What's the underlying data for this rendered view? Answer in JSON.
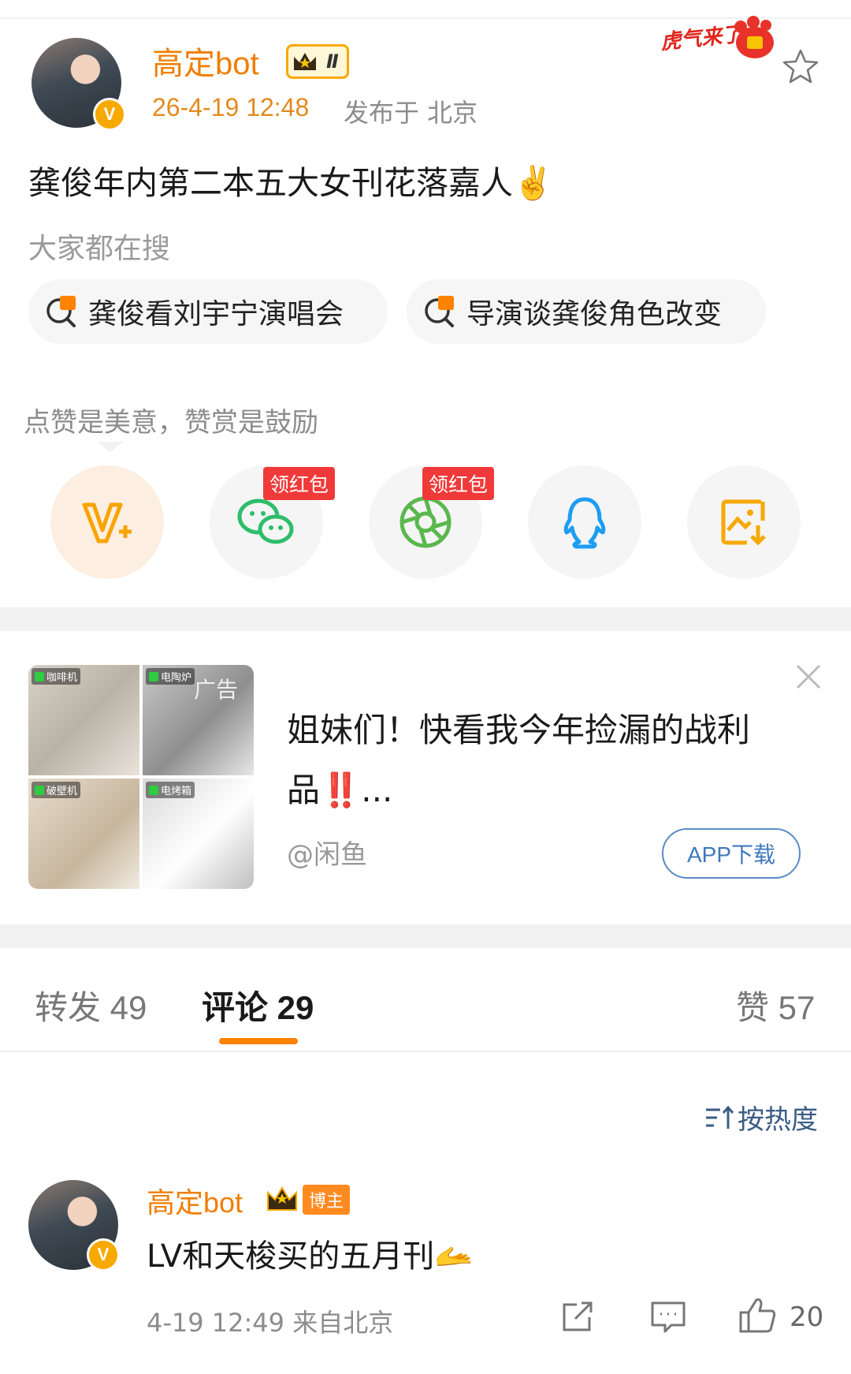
{
  "post": {
    "author": "高定bot",
    "level_badge": "Ⅱ",
    "time": "26-4-19 12:48",
    "location": "发布于 北京",
    "promo": "虎气来了",
    "text": "龚俊年内第二本五大女刊花落嘉人✌️",
    "search_title": "大家都在搜",
    "hot_searches": [
      {
        "label": "龚俊看刘宇宁演唱会"
      },
      {
        "label": "导演谈龚俊角色改变"
      }
    ]
  },
  "reward": {
    "title": "点赞是美意，赞赏是鼓励",
    "share_items": [
      {
        "icon": "v-plus-icon",
        "tag": ""
      },
      {
        "icon": "wechat-icon",
        "tag": "领红包"
      },
      {
        "icon": "moments-icon",
        "tag": "领红包"
      },
      {
        "icon": "qq-icon",
        "tag": ""
      },
      {
        "icon": "save-image-icon",
        "tag": ""
      }
    ]
  },
  "ad": {
    "label": "广告",
    "image_tags": [
      "咖啡机",
      "电陶炉",
      "破壁机",
      "电烤箱"
    ],
    "text": "姐妹们！快看我今年捡漏的战利品‼️...",
    "source": "@闲鱼",
    "button": "APP下载"
  },
  "tabs": {
    "repost": "转发 49",
    "comment": "评论 29",
    "like": "赞 57"
  },
  "sort_label": "按热度",
  "comment": {
    "author": "高定bot",
    "badge": "博主",
    "text": "LV和天梭买的五月刊🫴",
    "meta": "4-19 12:49 来自北京",
    "likes": "20"
  },
  "colors": {
    "accent_orange": "#ff8200",
    "author_orange": "#f07e00",
    "link_blue": "#3f78bd"
  }
}
